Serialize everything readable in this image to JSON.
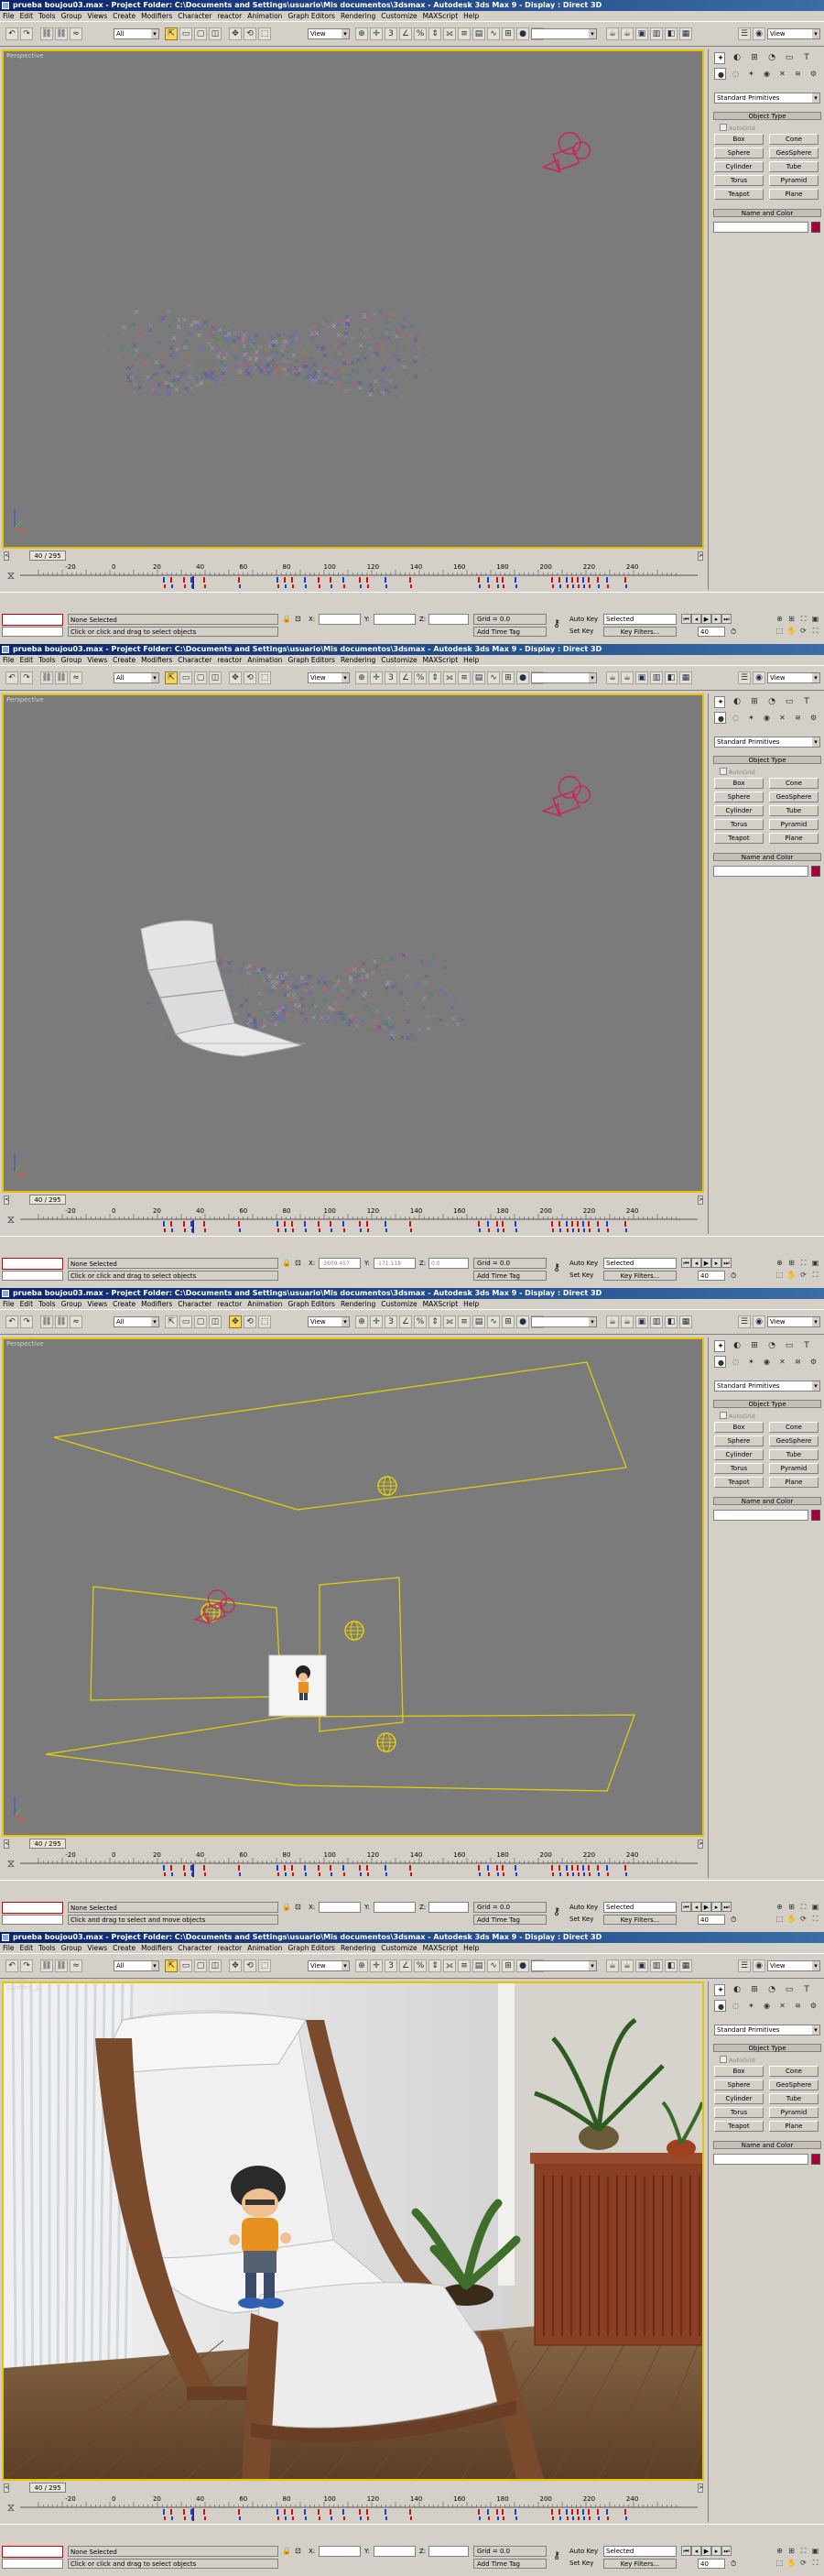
{
  "app": {
    "title": "prueba boujou03.max    - Project Folder: C:\\Documents and Settings\\usuario\\Mis documentos\\3dsmax    - Autodesk 3ds Max 9    - Display : Direct 3D",
    "menu": [
      "File",
      "Edit",
      "Tools",
      "Group",
      "Views",
      "Create",
      "Modifiers",
      "Character",
      "reactor",
      "Animation",
      "Graph Editors",
      "Rendering",
      "Customize",
      "MAXScript",
      "Help"
    ],
    "highlighted_menu": "MAXScript",
    "toolbar": {
      "filter_all": "All",
      "view_combo": "View",
      "right_view_combo": "View",
      "named_sel": ""
    }
  },
  "command_panel": {
    "dropdown": "Standard Primitives",
    "object_type_header": "Object Type",
    "autogrid": "AutoGrid",
    "buttons": [
      "Box",
      "Cone",
      "Sphere",
      "GeoSphere",
      "Cylinder",
      "Tube",
      "Torus",
      "Pyramid",
      "Teapot",
      "Plane"
    ],
    "name_color_header": "Name and Color"
  },
  "panels": [
    {
      "viewport_label": "Perspective",
      "time_slider": "40 / 295",
      "ruler_ticks": [
        "-20",
        "0",
        "20",
        "40",
        "60",
        "80",
        "100",
        "120",
        "140",
        "160",
        "180",
        "200",
        "220",
        "240"
      ],
      "selection": "None Selected",
      "prompt": "Click or click and drag to select objects",
      "x_value": "",
      "y_value": "",
      "z_value": "",
      "grid": "Grid = 0.0",
      "add_time_tag": "Add Time Tag",
      "auto_key": "Auto Key",
      "set_key": "Set Key",
      "selected": "Selected",
      "key_filters": "Key Filters...",
      "frame": "40"
    },
    {
      "viewport_label": "Perspective",
      "time_slider": "40 / 295",
      "ruler_ticks": [
        "-20",
        "0",
        "20",
        "40",
        "60",
        "80",
        "100",
        "120",
        "140",
        "160",
        "180",
        "200",
        "220",
        "240"
      ],
      "selection": "None Selected",
      "prompt": "Click or click and drag to select objects",
      "x_value": "-3609.457",
      "y_value": "-171.118",
      "z_value": "0.0",
      "grid": "Grid = 0.0",
      "add_time_tag": "Add Time Tag",
      "auto_key": "Auto Key",
      "set_key": "Set Key",
      "selected": "Selected",
      "key_filters": "Key Filters...",
      "frame": "40"
    },
    {
      "viewport_label": "Perspective",
      "time_slider": "40 / 295",
      "ruler_ticks": [
        "-20",
        "0",
        "20",
        "40",
        "60",
        "80",
        "100",
        "120",
        "140",
        "160",
        "180",
        "200",
        "220",
        "240"
      ],
      "selection": "None Selected",
      "prompt": "Click and drag to select and move objects",
      "x_value": "",
      "y_value": "",
      "z_value": "",
      "grid": "Grid = 0.0",
      "add_time_tag": "Add Time Tag",
      "auto_key": "Auto Key",
      "set_key": "Set Key",
      "selected": "Selected",
      "key_filters": "Key Filters...",
      "frame": "40"
    },
    {
      "viewport_label": "Camera_1",
      "time_slider": "40 / 295",
      "ruler_ticks": [
        "-20",
        "0",
        "20",
        "40",
        "60",
        "80",
        "100",
        "120",
        "140",
        "160",
        "180",
        "200",
        "220",
        "240"
      ],
      "selection": "None Selected",
      "prompt": "Click or click and drag to select objects",
      "x_value": "",
      "y_value": "",
      "z_value": "",
      "grid": "Grid = 0.0",
      "add_time_tag": "Add Time Tag",
      "auto_key": "Auto Key",
      "set_key": "Set Key",
      "selected": "Selected",
      "key_filters": "Key Filters...",
      "frame": "40"
    }
  ],
  "colors": {
    "title_bar": "#0a246a",
    "viewport_bg": "#7b7b7b",
    "viewport_border": "#e8c400",
    "active_tool": "#f7d65a",
    "object_color": "#a8003c",
    "camera_wire": "#c8285a",
    "light_wire": "#e8d000",
    "key_marks": "#d01010",
    "highlight_circle": "#e01010"
  }
}
